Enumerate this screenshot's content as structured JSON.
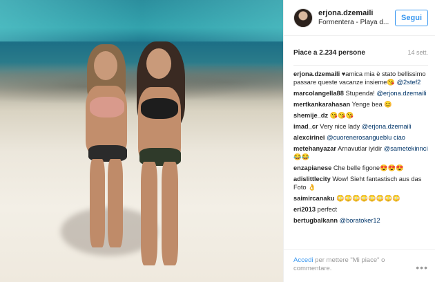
{
  "post": {
    "username": "erjona.dzemaili",
    "location": "Formentera - Playa d...",
    "follow_label": "Segui",
    "likes": "Piace a 2.234 persone",
    "time": "14 sett."
  },
  "comments": [
    {
      "user": "erjona.dzemaili",
      "text": "♥amica mia è stato bellissimo passare queste vacanze insieme😘 ",
      "mention": "@2stef2"
    },
    {
      "user": "marcolangella88",
      "text": "Stupenda! ",
      "mention": "@erjona.dzemaili"
    },
    {
      "user": "mertkankarahasan",
      "text": "Yenge bea 😊",
      "mention": ""
    },
    {
      "user": "shemije_dz",
      "text": "😘😘😘",
      "mention": ""
    },
    {
      "user": "imad_cr",
      "text": "Very nice lady ",
      "mention": "@erjona.dzemaili"
    },
    {
      "user": "alexcirinei",
      "text": "",
      "mention": "@cuorenerosangueblu ciao"
    },
    {
      "user": "metehanyazar",
      "text": "Arnavutlar iyidir ",
      "mention": "@sametekinnci 😂😂"
    },
    {
      "user": "enzapianese",
      "text": "Che belle figone😍😍😍",
      "mention": ""
    },
    {
      "user": "adislittlecity",
      "text": "Wow! Sieht fantastisch aus das Foto 👌",
      "mention": ""
    },
    {
      "user": "saimircanaku",
      "text": "😳😳😳😳😳😳😳😳",
      "mention": ""
    },
    {
      "user": "eri2013",
      "text": "perfect",
      "mention": ""
    },
    {
      "user": "bertugbalkann",
      "text": "",
      "mention": "@boratoker12"
    }
  ],
  "footer": {
    "login_link": "Accedi",
    "login_rest": " per mettere \"Mi piace\" o commentare.",
    "more_icon": "ellipsis-icon"
  },
  "colors": {
    "accent": "#3897f0",
    "mention": "#003569",
    "muted": "#999999"
  }
}
